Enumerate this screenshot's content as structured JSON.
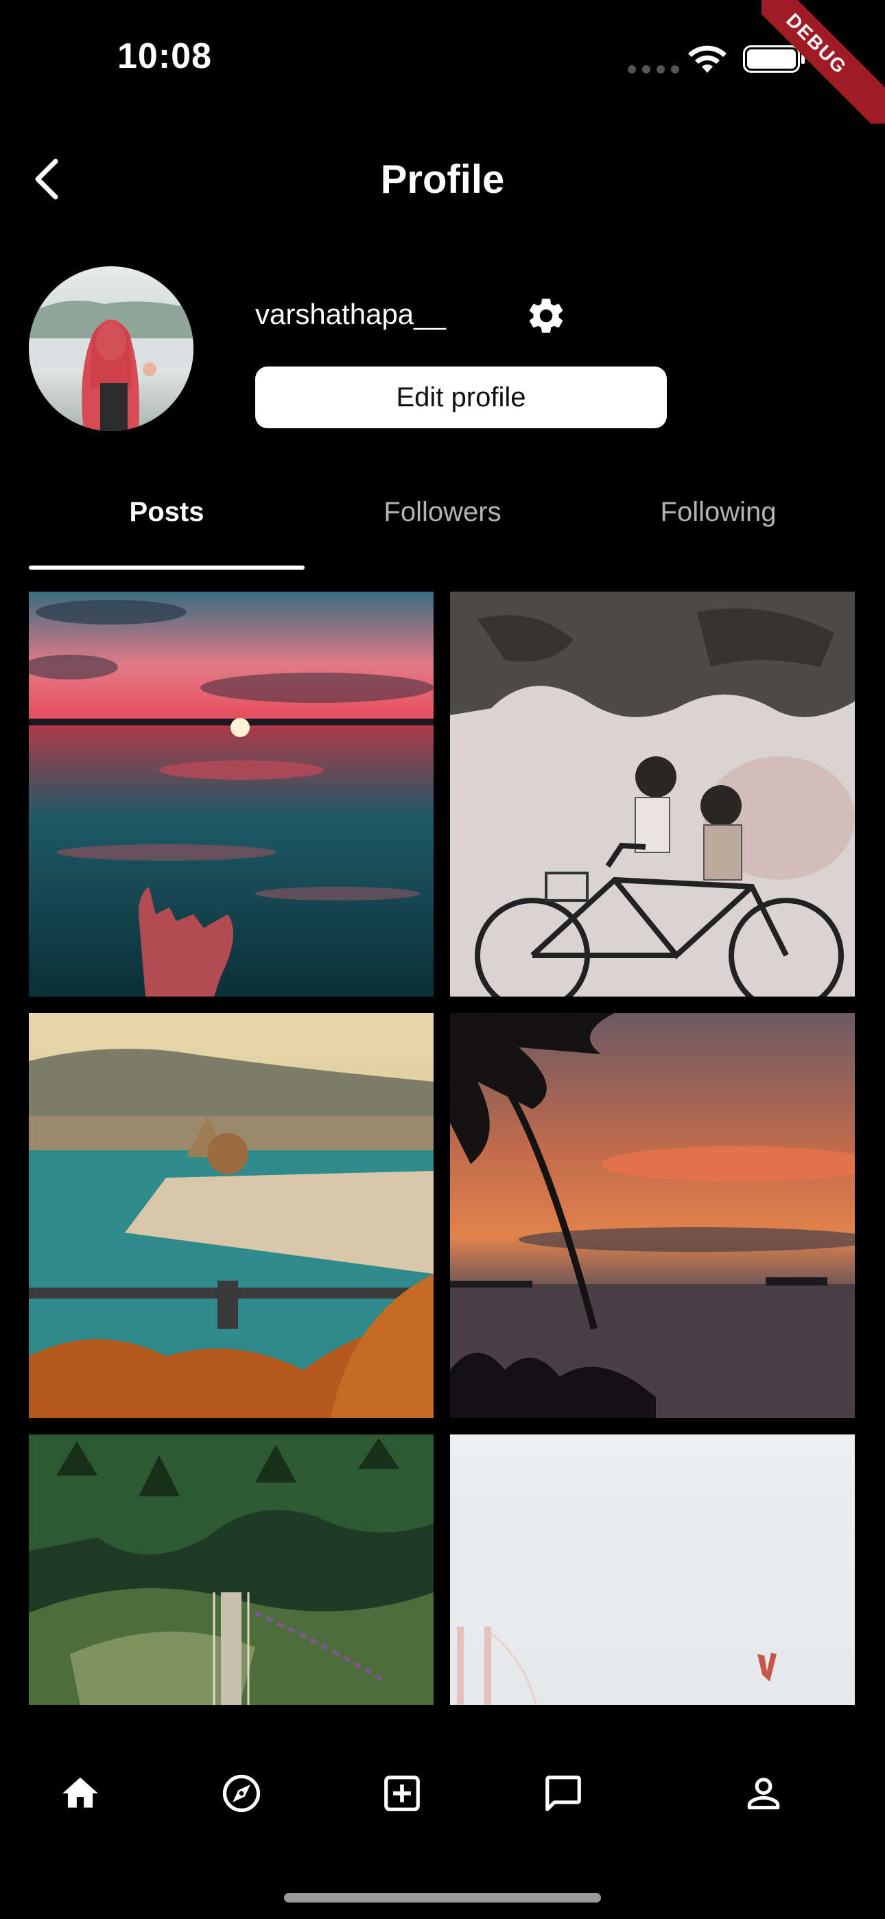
{
  "status_bar": {
    "time": "10:08",
    "debug_label": "DEBUG"
  },
  "header": {
    "title": "Profile"
  },
  "profile": {
    "username": "varshathapa__",
    "edit_label": "Edit profile"
  },
  "tabs": [
    {
      "label": "Posts",
      "active": true
    },
    {
      "label": "Followers",
      "active": false
    },
    {
      "label": "Following",
      "active": false
    }
  ],
  "posts": [
    {
      "subject": "sunset over water with hand"
    },
    {
      "subject": "street art children on bicycle"
    },
    {
      "subject": "city by the river with parliament"
    },
    {
      "subject": "palm silhouette at sunset over sea"
    },
    {
      "subject": "forest with suspension bridge"
    },
    {
      "subject": "foggy bridge with raised hand"
    }
  ],
  "bottom_nav": [
    {
      "icon": "home-icon"
    },
    {
      "icon": "explore-icon"
    },
    {
      "icon": "add-post-icon"
    },
    {
      "icon": "chat-icon"
    },
    {
      "icon": "profile-icon"
    }
  ],
  "colors": {
    "background": "#000000",
    "text": "#ffffff",
    "inactive_tab": "#b3b3b3",
    "debug_ribbon": "#a01c24"
  }
}
